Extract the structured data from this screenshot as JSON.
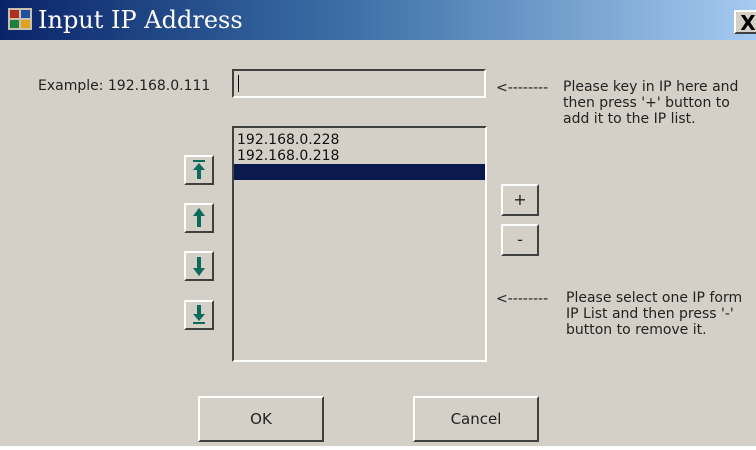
{
  "window": {
    "title": "Input IP Address",
    "close_label": "X"
  },
  "example_label": "Example: 192.168.0.111",
  "ip_input": {
    "value": ""
  },
  "arrow_hint_top": "<--------",
  "arrow_hint_bottom": "<--------",
  "hint_add": "Please key in IP here and\nthen press '+' button to\nadd it to the IP list.",
  "hint_remove": "Please select one IP form\nIP List and then press '-'\nbutton to remove it.",
  "ip_list": {
    "items": [
      "192.168.0.228",
      "192.168.0.218",
      ""
    ],
    "selected_index": 2
  },
  "add_button": "+",
  "remove_button": "-",
  "ok_button": "OK",
  "cancel_button": "Cancel",
  "icons": {
    "move_top": "move-to-top-icon",
    "move_up": "move-up-icon",
    "move_down": "move-down-icon",
    "move_bottom": "move-to-bottom-icon"
  },
  "colors": {
    "title_gradient_start": "#0a246a",
    "title_gradient_end": "#a6caf0",
    "face": "#d4d0c8",
    "selection": "#0a1a4c",
    "arrow_icon": "#0b6a5a"
  }
}
